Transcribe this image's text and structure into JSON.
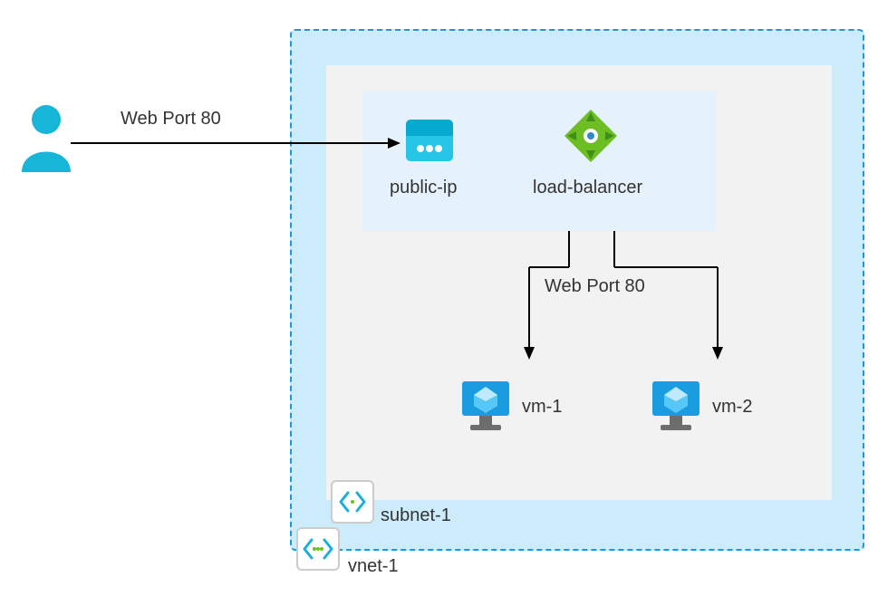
{
  "arrows": {
    "user_to_publicip_label": "Web Port 80",
    "lb_to_vms_label": "Web Port 80"
  },
  "nodes": {
    "public_ip": {
      "label": "public-ip"
    },
    "load_balancer": {
      "label": "load-balancer"
    },
    "vm1": {
      "label": "vm-1"
    },
    "vm2": {
      "label": "vm-2"
    }
  },
  "containers": {
    "subnet": {
      "label": "subnet-1"
    },
    "vnet": {
      "label": "vnet-1"
    }
  }
}
